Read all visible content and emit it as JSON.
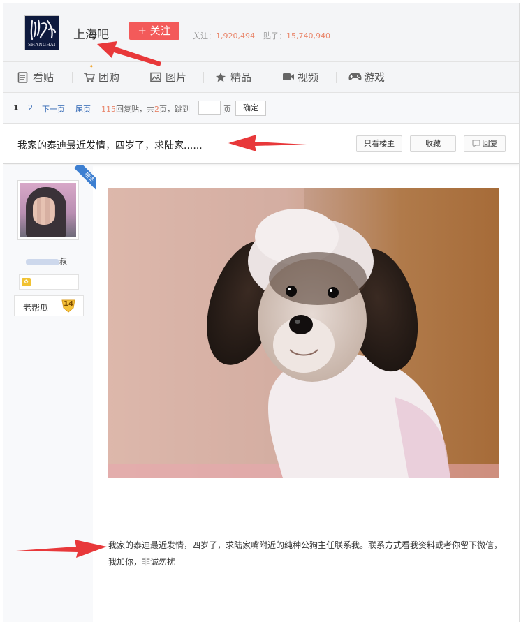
{
  "forum": {
    "logo_text": "SHANGHAI",
    "name": "上海吧",
    "follow_label": "+ 关注",
    "followers_label": "关注：",
    "followers": "1,920,494",
    "posts_label": "贴子：",
    "posts": "15,740,940"
  },
  "nav": {
    "items": [
      {
        "label": "看贴",
        "icon": "document-icon"
      },
      {
        "label": "团购",
        "icon": "cart-icon"
      },
      {
        "label": "图片",
        "icon": "image-icon"
      },
      {
        "label": "精品",
        "icon": "star-icon"
      },
      {
        "label": "视频",
        "icon": "video-icon"
      },
      {
        "label": "游戏",
        "icon": "gamepad-icon"
      }
    ]
  },
  "pager": {
    "page1": "1",
    "page2": "2",
    "next": "下一页",
    "last": "尾页",
    "reply_count": "115",
    "reply_text": "回复贴，共",
    "total_pages": "2",
    "jump_text": "页，跳到",
    "page_unit": "页",
    "confirm": "确定"
  },
  "thread": {
    "title": "我家的泰迪最近发情，四岁了，求陆家......",
    "only_op": "只看楼主",
    "collect": "收藏",
    "reply": "回复"
  },
  "author": {
    "op_badge": "楼主",
    "name_suffix": "叔",
    "rank": "老帮瓜",
    "level": "14"
  },
  "post": {
    "body": "我家的泰迪最近发情，四岁了，求陆家嘴附近的纯种公狗主任联系我。联系方式看我资料或者你留下微信，我加你，非诚勿扰"
  },
  "colors": {
    "follow_button": "#f35a5a",
    "link": "#2d64b3",
    "count": "#e9866b",
    "arrow": "#e8383a",
    "op_badge": "#3d7fd1"
  }
}
